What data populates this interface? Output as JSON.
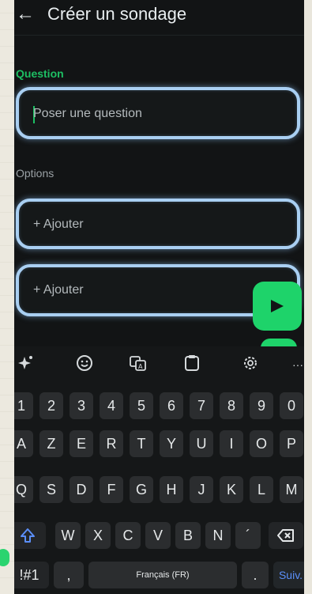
{
  "header": {
    "back_icon": "back-arrow-icon",
    "title": "Créer un sondage"
  },
  "form": {
    "question_label": "Question",
    "question_placeholder": "Poser une question",
    "options_label": "Options",
    "option1_placeholder": "+ Ajouter",
    "option2_placeholder": "+ Ajouter"
  },
  "keyboard": {
    "toolbar_icons": [
      "sparkle-icon",
      "emoji-icon",
      "translate-icon",
      "clipboard-icon",
      "settings-icon",
      "more-icon"
    ],
    "more_label": "···",
    "number_row": [
      "1",
      "2",
      "3",
      "4",
      "5",
      "6",
      "7",
      "8",
      "9",
      "0"
    ],
    "row1": [
      "A",
      "Z",
      "E",
      "R",
      "T",
      "Y",
      "U",
      "I",
      "O",
      "P"
    ],
    "row2": [
      "Q",
      "S",
      "D",
      "F",
      "G",
      "H",
      "J",
      "K",
      "L",
      "M"
    ],
    "row3": [
      "W",
      "X",
      "C",
      "V",
      "B",
      "N",
      "´"
    ],
    "symbols_label": "!#1",
    "comma_label": ",",
    "space_label": "Français (FR)",
    "period_label": ".",
    "next_label": "Suiv."
  },
  "colors": {
    "accent_green": "#1ed36a",
    "field_border": "#a9cff2",
    "background": "#121415",
    "next_blue": "#5b8ff9"
  }
}
